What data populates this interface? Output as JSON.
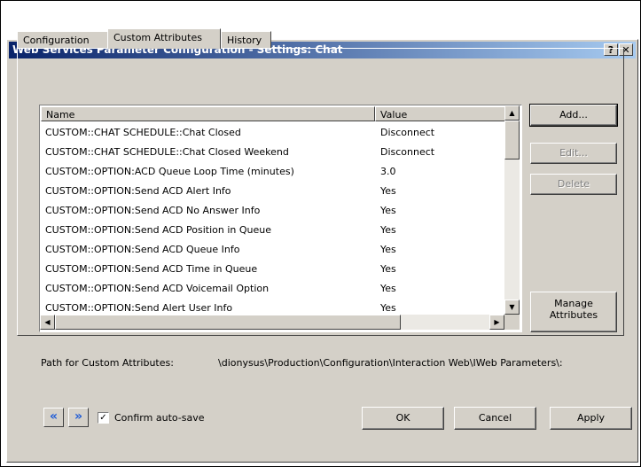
{
  "window": {
    "title": "Web Services Parameter Configuration - Settings: Chat",
    "help_label": "?",
    "close_label": "✕"
  },
  "tabs": [
    {
      "label": "Configuration",
      "active": false
    },
    {
      "label": "Custom Attributes",
      "active": true
    },
    {
      "label": "History",
      "active": false
    }
  ],
  "list": {
    "columns": {
      "name": "Name",
      "value": "Value"
    },
    "rows": [
      {
        "name": "CUSTOM::CHAT SCHEDULE::Chat Closed",
        "value": "Disconnect"
      },
      {
        "name": "CUSTOM::CHAT SCHEDULE::Chat Closed Weekend",
        "value": "Disconnect"
      },
      {
        "name": "CUSTOM::OPTION:ACD Queue Loop Time (minutes)",
        "value": "3.0"
      },
      {
        "name": "CUSTOM::OPTION:Send ACD Alert Info",
        "value": "Yes"
      },
      {
        "name": "CUSTOM::OPTION:Send ACD No Answer Info",
        "value": "Yes"
      },
      {
        "name": "CUSTOM::OPTION:Send ACD Position in Queue",
        "value": "Yes"
      },
      {
        "name": "CUSTOM::OPTION:Send ACD Queue Info",
        "value": "Yes"
      },
      {
        "name": "CUSTOM::OPTION:Send ACD Time in Queue",
        "value": "Yes"
      },
      {
        "name": "CUSTOM::OPTION:Send ACD Voicemail Option",
        "value": "Yes"
      },
      {
        "name": "CUSTOM::OPTION:Send Alert User Info",
        "value": "Yes"
      }
    ]
  },
  "buttons": {
    "add": "Add...",
    "edit": "Edit...",
    "delete": "Delete",
    "manage_line1": "Manage",
    "manage_line2": "Attributes",
    "ok": "OK",
    "cancel": "Cancel",
    "apply": "Apply"
  },
  "path": {
    "label": "Path for Custom Attributes:",
    "value": "\\dionysus\\Production\\Configuration\\Interaction Web\\IWeb Parameters\\:"
  },
  "footer": {
    "prev_glyph": "«",
    "next_glyph": "»",
    "confirm_label": "Confirm auto-save",
    "confirm_checked": true,
    "check_glyph": "✓"
  },
  "colors": {
    "titlebar_start": "#0a246a",
    "titlebar_end": "#a6caf0",
    "dialog_face": "#d4d0c8",
    "nav_arrow": "#1e5bd6"
  },
  "icons": {
    "prev": "double-chevron-left-icon",
    "next": "double-chevron-right-icon",
    "scroll_up": "arrow-up-icon",
    "scroll_down": "arrow-down-icon",
    "scroll_left": "arrow-left-icon",
    "scroll_right": "arrow-right-icon"
  }
}
